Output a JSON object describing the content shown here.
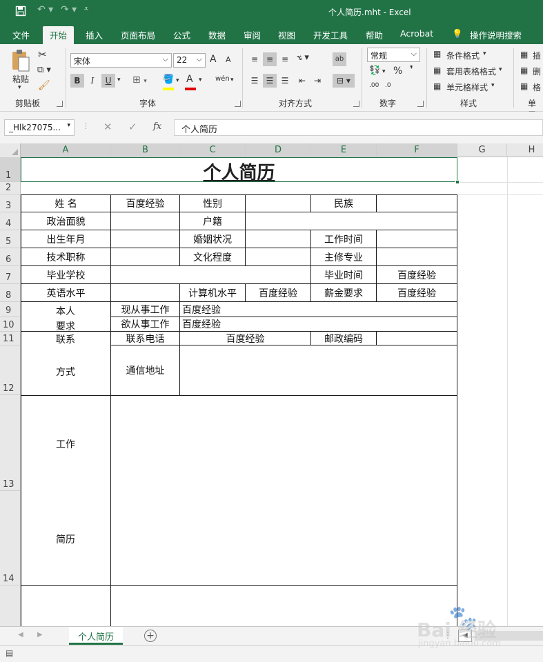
{
  "window": {
    "title": "个人简历.mht  -  Excel"
  },
  "menu_tabs": [
    "文件",
    "开始",
    "插入",
    "页面布局",
    "公式",
    "数据",
    "审阅",
    "视图",
    "开发工具",
    "帮助",
    "Acrobat"
  ],
  "tell_me": "操作说明搜索",
  "ribbon": {
    "clipboard": {
      "paste": "粘贴",
      "label": "剪贴板"
    },
    "font": {
      "name": "宋体",
      "size": "22",
      "grow": "A",
      "shrink": "A",
      "bold": "B",
      "italic": "I",
      "underline": "U",
      "fill_letter": "A",
      "wen": "wén",
      "label": "字体"
    },
    "alignment": {
      "label": "对齐方式",
      "wrap": "ab"
    },
    "number": {
      "format": "常规",
      "percent": "%",
      "comma": "❜",
      "inc": ".00",
      "dec": ".0",
      "label": "数字"
    },
    "styles": {
      "conditional": "条件格式",
      "table": "套用表格格式",
      "cell": "单元格样式",
      "label": "样式"
    },
    "cells": {
      "insert": "插",
      "delete": "删",
      "format": "格",
      "label": "单元"
    }
  },
  "formula_bar": {
    "name_box": "_Hlk27075...",
    "fx": "fx",
    "value": "个人简历"
  },
  "columns": [
    "A",
    "B",
    "C",
    "D",
    "E",
    "F",
    "G",
    "H"
  ],
  "rows": [
    "1",
    "2",
    "3",
    "4",
    "5",
    "6",
    "7",
    "8",
    "9",
    "10",
    "11",
    "12",
    "13",
    "14"
  ],
  "form": {
    "title": "个人简历",
    "r3": {
      "name": "姓    名",
      "name_val": "百度经验",
      "gender": "性别",
      "ethnic": "民族"
    },
    "r4": {
      "politics": "政治面貌",
      "hukou": "户籍"
    },
    "r5": {
      "birth": "出生年月",
      "marriage": "婚姻状况",
      "work_time": "工作时间"
    },
    "r6": {
      "title": "技术职称",
      "edu": "文化程度",
      "major": "主修专业"
    },
    "r7": {
      "school": "毕业学校",
      "grad_time": "毕业时间",
      "grad_val": "百度经验"
    },
    "r8": {
      "english": "英语水平",
      "computer": "计算机水平",
      "computer_val": "百度经验",
      "salary": "薪金要求",
      "salary_val": "百度经验"
    },
    "r9": {
      "self": "本人",
      "current_job": "现从事工作",
      "current_val": "百度经验"
    },
    "r10": {
      "req": "要求",
      "desired_job": "欲从事工作",
      "desired_val": "百度经验"
    },
    "r11": {
      "contact": "联系",
      "phone": "联系电话",
      "phone_val": "百度经验",
      "postcode": "邮政编码"
    },
    "r12": {
      "way": "方式",
      "address": "通信地址"
    },
    "r13": {
      "work": "工作",
      "history": "简历"
    }
  },
  "sheet_tab": "个人简历",
  "watermark": {
    "brand": "Bai 经验",
    "url": "jingyan.baidu.com"
  },
  "colors": {
    "excel_green": "#217346",
    "ribbon_bg": "#f3f3f3"
  }
}
